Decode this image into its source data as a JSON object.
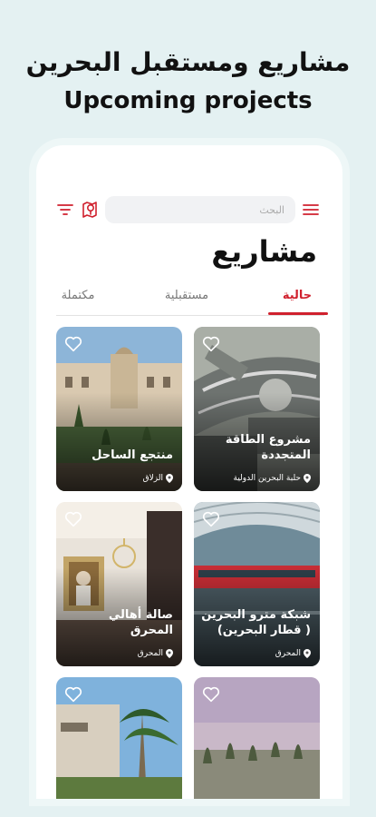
{
  "promo": {
    "headline_ar": "مشاريع ومستقبل البحرين",
    "headline_en": "Upcoming projects"
  },
  "header": {
    "search_placeholder": "البحث",
    "page_title": "مشاريع"
  },
  "tabs": [
    {
      "label": "حالية",
      "active": true
    },
    {
      "label": "مستقبلية",
      "active": false
    },
    {
      "label": "مكتملة",
      "active": false
    }
  ],
  "colors": {
    "accent": "#d0212e",
    "background": "#e4f1f2"
  },
  "projects": [
    {
      "title": "مشروع الطاقة المتجددة",
      "location": "حلبة البحرين الدولية"
    },
    {
      "title": "منتجع الساحل",
      "location": "الزلاق"
    },
    {
      "title": "شبكة مترو البحرين ( قطار البحرين)",
      "location": "المحرق"
    },
    {
      "title": "صالة أهالي المحرق",
      "location": "المحرق"
    },
    {
      "title": "",
      "location": ""
    },
    {
      "title": "",
      "location": ""
    }
  ]
}
